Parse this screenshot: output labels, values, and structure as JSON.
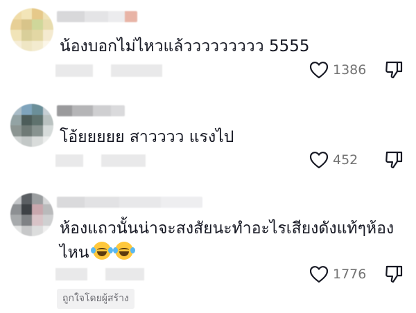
{
  "comments": [
    {
      "text": "น้องบอกไม่ไหวแล้ววววววววว 5555",
      "likes": "1386",
      "avatar_colors": [
        "#f0dca8",
        "#f3e5b8",
        "#e6c98a",
        "#efe2b6",
        "#e7cf96",
        "#d8c48a",
        "#cfd79a",
        "#e8dcae",
        "#f1e4b8",
        "#d9cf9a",
        "#e2d7a4",
        "#f4ead0",
        "#f6eed8",
        "#efe6c4",
        "#f3ebcf",
        "#fbf6e8"
      ]
    },
    {
      "text": "โอ้ยยยยย สาวววว แรงไป",
      "likes": "452",
      "avatar_colors": [
        "#a9bcc7",
        "#7fa4bc",
        "#6b8f99",
        "#c7cfd4",
        "#93a3a4",
        "#4d5d5a",
        "#5f726e",
        "#b9c1c0",
        "#8c9592",
        "#6f7a76",
        "#889390",
        "#d6dbda",
        "#cfd3d2",
        "#c3c8c7",
        "#d9dcdb",
        "#eceeed"
      ]
    },
    {
      "text": "ห้องแถวนั้นน่าจะสงสัยนะทำอะไรเสียงดังแท้ๆห้องไหน",
      "likes": "1776",
      "creator_badge": "ถูกใจโดยผู้สร้าง",
      "avatar_colors": [
        "#c4c6c8",
        "#5b5f63",
        "#9b9ea0",
        "#d5d6d7",
        "#8d9093",
        "#3e4246",
        "#c8a7ad",
        "#b9babb",
        "#a7aaac",
        "#7f8285",
        "#d8c3c7",
        "#cfd0d1",
        "#e2e3e3",
        "#c7c8c9",
        "#dcdddd",
        "#efefef"
      ]
    }
  ],
  "colors": {
    "text": "#161823",
    "muted": "#737373",
    "icon": "#161823",
    "badge_bg": "#f1f1f2"
  },
  "icons": {
    "like": "heart-outline-icon",
    "dislike": "thumbs-down-outline-icon",
    "emoji": "face-with-tears-of-joy"
  }
}
